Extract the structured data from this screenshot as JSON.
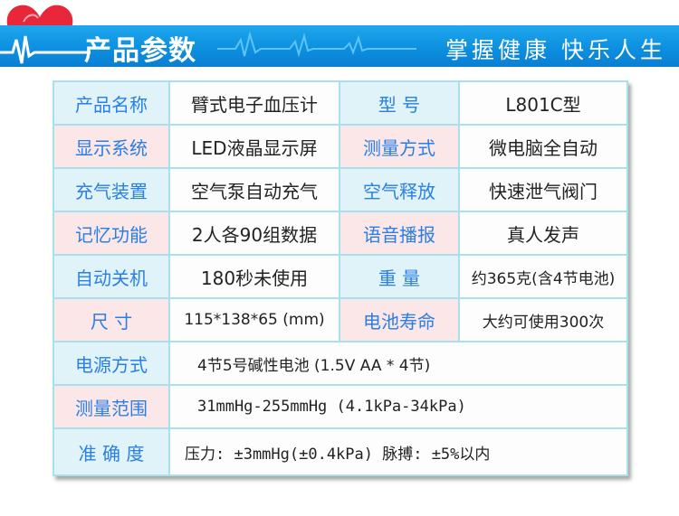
{
  "header": {
    "title": "产品参数",
    "slogan": "掌握健康  快乐人生",
    "brand_color": "#0d8fe0",
    "heart_color": "#e8273a"
  },
  "rows": [
    {
      "label": "产品名称",
      "value": "臂式电子血压计",
      "label2": "型      号",
      "value2": "L801C型"
    },
    {
      "label": "显示系统",
      "value": "LED液晶显示屏",
      "label2": "测量方式",
      "value2": "微电脑全自动"
    },
    {
      "label": "充气装置",
      "value": "空气泵自动充气",
      "label2": "空气释放",
      "value2": "快速泄气阀门"
    },
    {
      "label": "记忆功能",
      "value": "2人各90组数据",
      "label2": "语音播报",
      "value2": "真人发声"
    },
    {
      "label": "自动关机",
      "value": "180秒未使用",
      "label2": "重      量",
      "value2": "约365克(含4节电池)"
    },
    {
      "label": "尺      寸",
      "value": "115*138*65 (mm)",
      "label2": "电池寿命",
      "value2": "大约可使用300次"
    },
    {
      "label": "电源方式",
      "value": "4节5号碱性电池 (1.5V AA * 4节)"
    },
    {
      "label": "测量范围",
      "value": "31mmHg-255mmHg (4.1kPa-34kPa)"
    },
    {
      "label": "准 确 度",
      "value": "压力: ±3mmHg(±0.4kPa) 脉搏: ±5%以内"
    }
  ]
}
